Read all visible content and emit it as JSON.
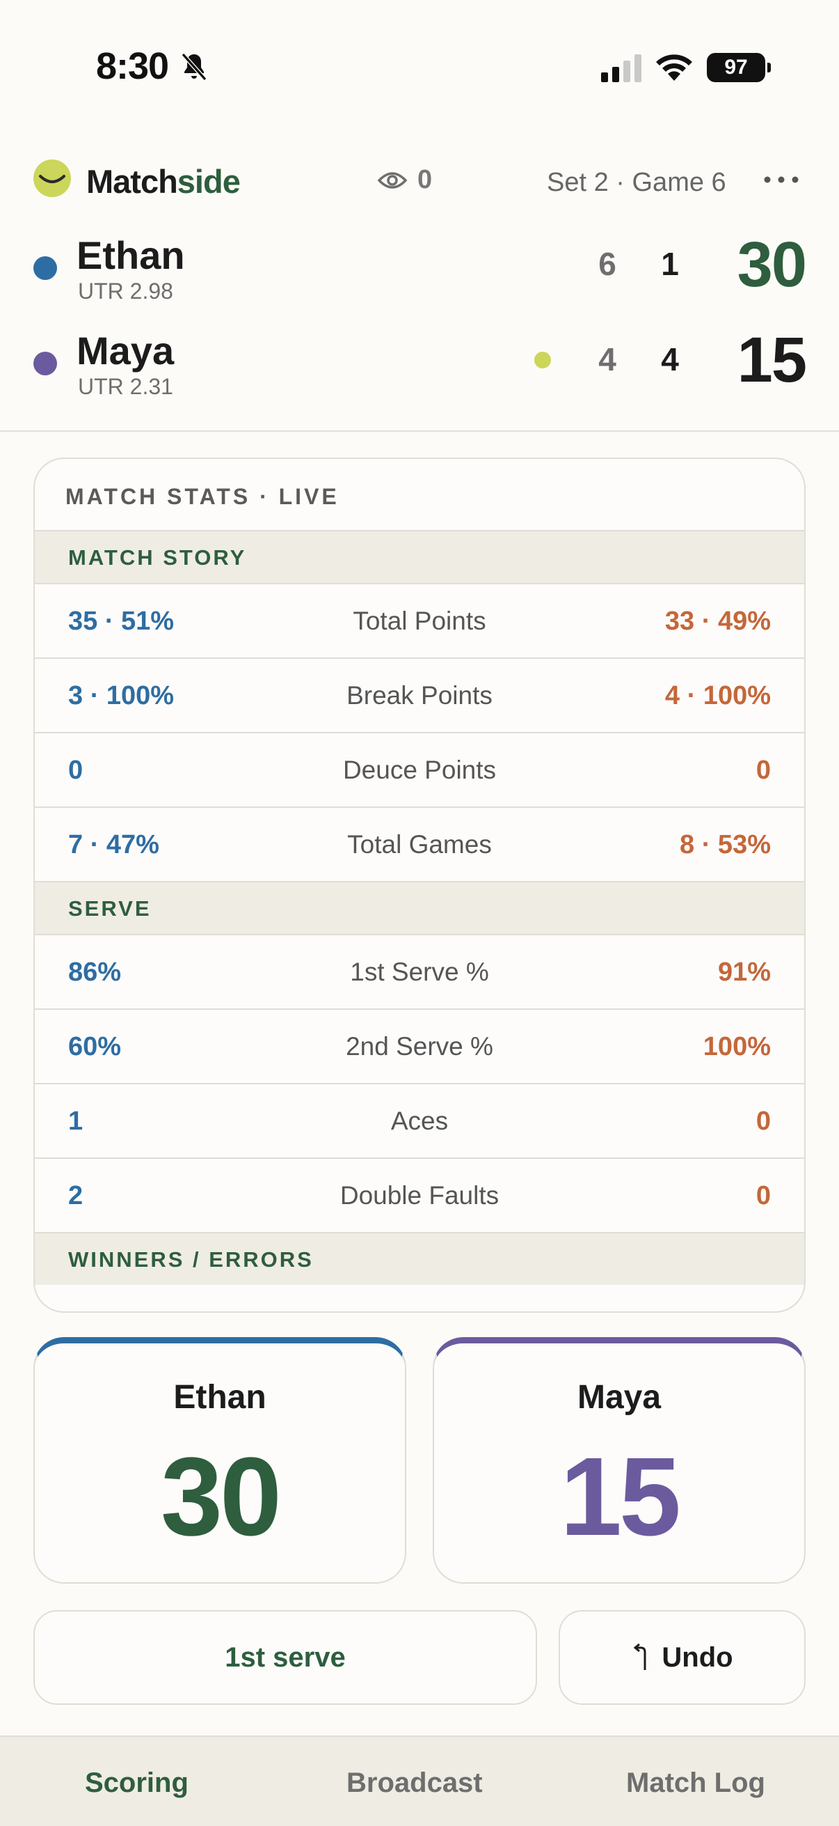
{
  "status_bar": {
    "time": "8:30",
    "battery": "97"
  },
  "header": {
    "brand_part1": "Match",
    "brand_part2": "side",
    "viewers": "0",
    "set_game": "Set 2 · Game 6"
  },
  "players": [
    {
      "name": "Ethan",
      "utr": "UTR 2.98",
      "set1": "6",
      "set2": "1",
      "points": "30",
      "color": "#2e6da3"
    },
    {
      "name": "Maya",
      "utr": "UTR 2.31",
      "set1": "4",
      "set2": "4",
      "points": "15",
      "color": "#6b5b9e"
    }
  ],
  "stats": {
    "title": "MATCH STATS · LIVE",
    "sections": [
      {
        "header": "MATCH STORY",
        "rows": [
          {
            "left": "35 · 51%",
            "label": "Total Points",
            "right": "33 · 49%"
          },
          {
            "left": "3 · 100%",
            "label": "Break Points",
            "right": "4 · 100%"
          },
          {
            "left": "0",
            "label": "Deuce Points",
            "right": "0"
          },
          {
            "left": "7 · 47%",
            "label": "Total Games",
            "right": "8 · 53%"
          }
        ]
      },
      {
        "header": "SERVE",
        "rows": [
          {
            "left": "86%",
            "label": "1st Serve %",
            "right": "91%"
          },
          {
            "left": "60%",
            "label": "2nd Serve %",
            "right": "100%"
          },
          {
            "left": "1",
            "label": "Aces",
            "right": "0"
          },
          {
            "left": "2",
            "label": "Double Faults",
            "right": "0"
          }
        ]
      },
      {
        "header": "WINNERS / ERRORS"
      }
    ]
  },
  "point_buttons": [
    {
      "name": "Ethan",
      "score": "30"
    },
    {
      "name": "Maya",
      "score": "15"
    }
  ],
  "actions": {
    "serve": "1st serve",
    "undo": "Undo"
  },
  "tabs": [
    {
      "label": "Scoring",
      "active": true
    },
    {
      "label": "Broadcast",
      "active": false
    },
    {
      "label": "Match Log",
      "active": false
    }
  ],
  "colors": {
    "brand_green": "#2e5e3e",
    "ethan_blue": "#2e6da3",
    "maya_purple": "#6b5b9e",
    "stat_orange": "#c4673a",
    "serve_ball": "#cbd65a"
  }
}
